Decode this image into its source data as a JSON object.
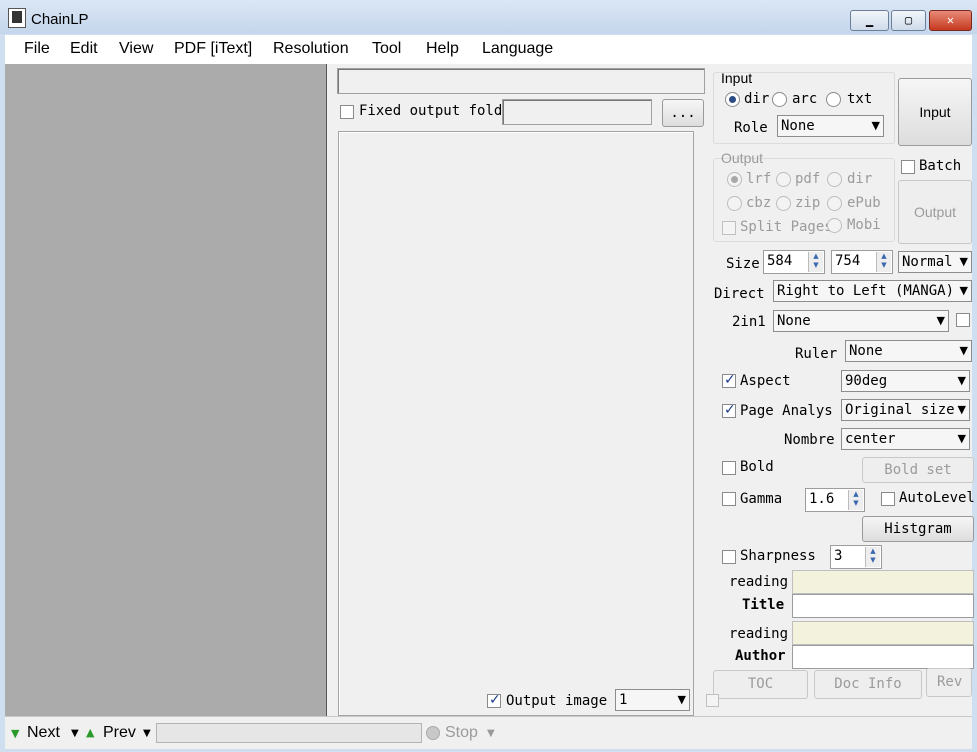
{
  "window": {
    "title": "ChainLP",
    "min": "▁",
    "max": "▢",
    "close": "✕"
  },
  "menu": [
    "File",
    "Edit",
    "View",
    "PDF [iText]",
    "Resolution",
    "Tool",
    "Help",
    "Language"
  ],
  "middle": {
    "fixed_output_label": "Fixed output folde",
    "browse_label": "...",
    "output_image_label": "Output image",
    "output_image_value": "1"
  },
  "input_group": {
    "title": "Input",
    "radios": [
      "dir",
      "arc",
      "txt"
    ],
    "selected": "dir",
    "role_label": "Role",
    "role_value": "None",
    "button": "Input"
  },
  "batch_label": "Batch",
  "output_group": {
    "title": "Output",
    "radios": [
      "lrf",
      "pdf",
      "dir",
      "cbz",
      "zip",
      "ePub",
      "Mobi"
    ],
    "selected": "lrf",
    "split_pages": "Split Pages",
    "button": "Output"
  },
  "size": {
    "label": "Size",
    "width": "584",
    "height": "754",
    "mode": "Normal"
  },
  "direct": {
    "label": "Direct",
    "value": "Right to Left (MANGA)"
  },
  "twoin1": {
    "label": "2in1",
    "value": "None"
  },
  "ruler": {
    "label": "Ruler",
    "value": "None"
  },
  "aspect": {
    "label": "Aspect",
    "value": "90deg",
    "checked": true
  },
  "page_analysis": {
    "label": "Page Analys",
    "value": "Original size",
    "checked": true
  },
  "nombre": {
    "label": "Nombre",
    "value": "center"
  },
  "bold": {
    "label": "Bold",
    "button": "Bold set"
  },
  "gamma": {
    "label": "Gamma",
    "value": "1.6",
    "autolevel": "AutoLevel",
    "histgram": "Histgram"
  },
  "sharpness": {
    "label": "Sharpness",
    "value": "3"
  },
  "title_field": {
    "reading_label": "reading",
    "label": "Title"
  },
  "author_field": {
    "reading_label": "reading",
    "label": "Author"
  },
  "bottom_buttons": [
    "TOC",
    "Doc Info",
    "Rev"
  ],
  "status": {
    "next": "Next",
    "prev": "Prev",
    "stop": "Stop"
  }
}
